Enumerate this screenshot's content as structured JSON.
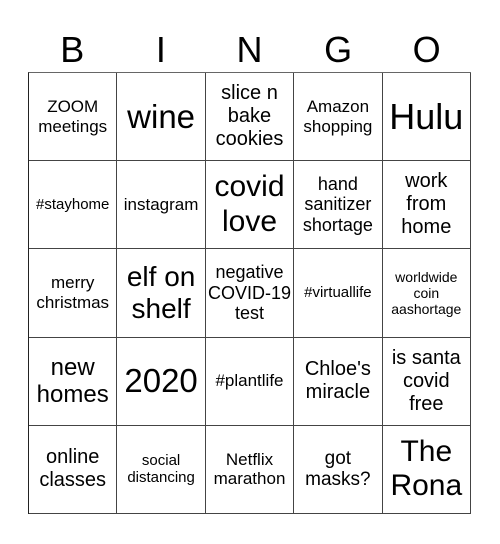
{
  "header": [
    "B",
    "I",
    "N",
    "G",
    "O"
  ],
  "cells": [
    "ZOOM meetings",
    "wine",
    "slice n bake cookies",
    "Amazon shopping",
    "Hulu",
    "#stayhome",
    "instagram",
    "covid love",
    "hand sanitizer shortage",
    "work from home",
    "merry christmas",
    "elf on shelf",
    "negative COVID-19 test",
    "#virtuallife",
    "worldwide coin aashortage",
    "new homes",
    "2020",
    "#plantlife",
    "Chloe's miracle",
    "is santa covid free",
    "online classes",
    "social distancing",
    "Netflix marathon",
    "got masks?",
    "The Rona"
  ]
}
